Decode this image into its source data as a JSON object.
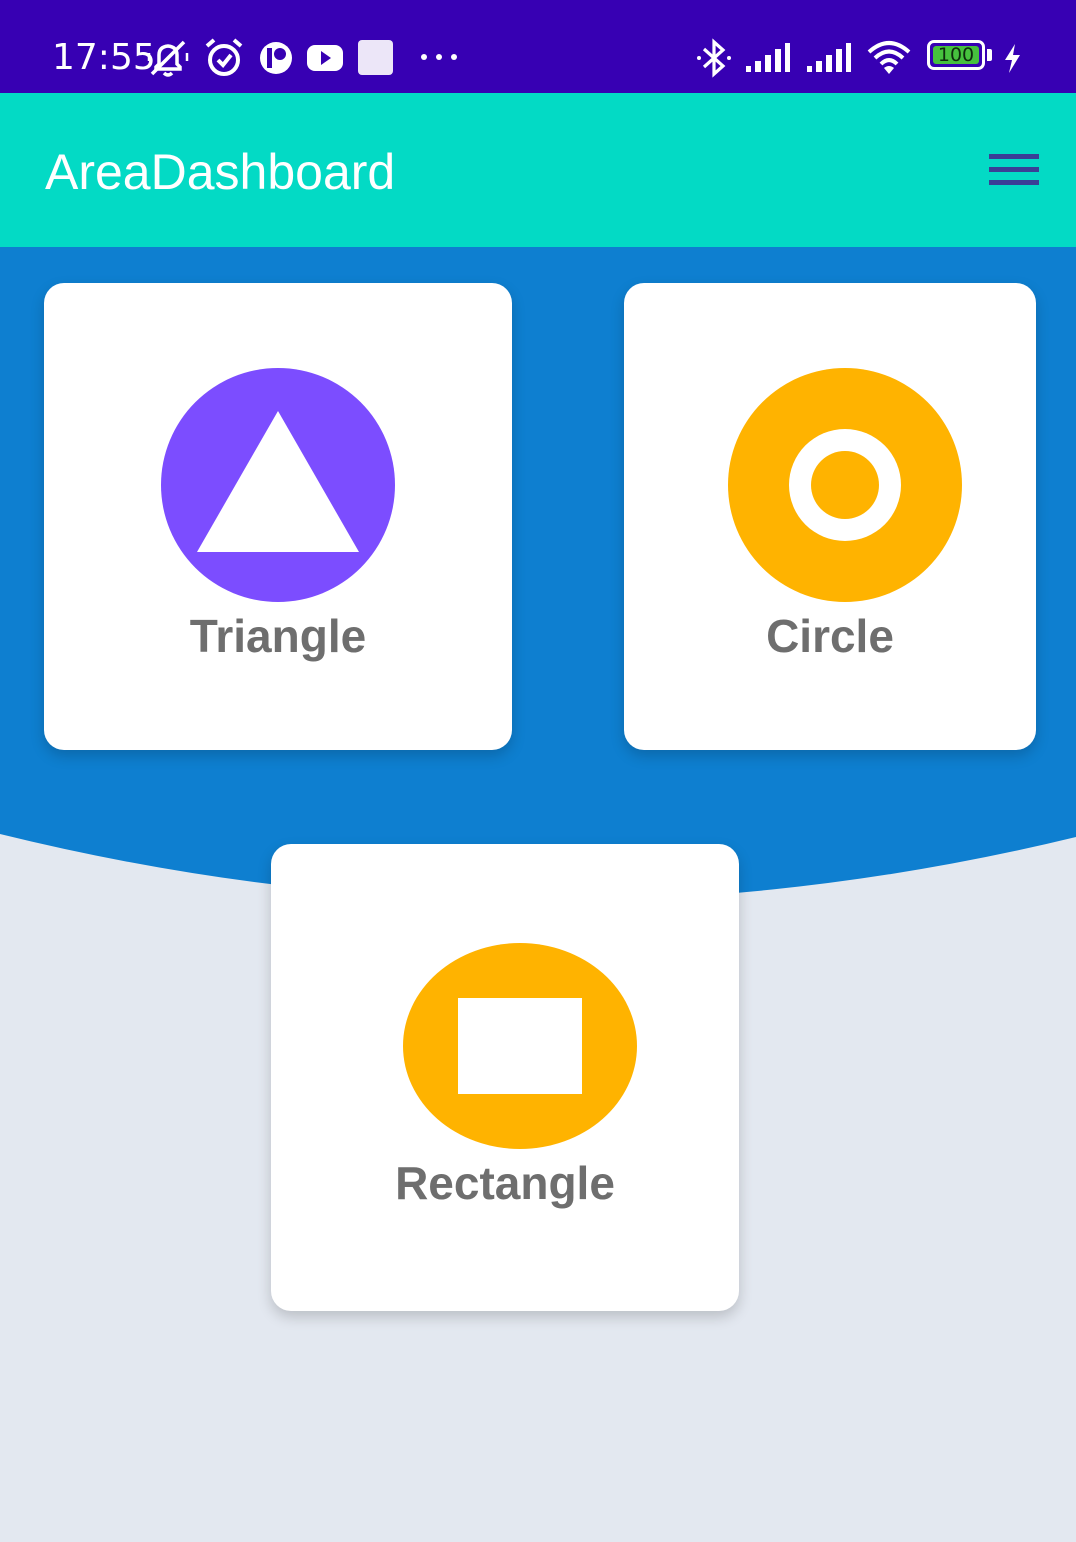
{
  "status_bar": {
    "time": "17:55",
    "battery_level": "100",
    "icons": [
      "mute-notifications-icon",
      "alarm-icon",
      "app-notification-icon",
      "youtube-icon",
      "app-square-icon",
      "more-dots-icon",
      "bluetooth-icon",
      "signal-icon",
      "signal-icon",
      "wifi-icon",
      "battery-icon",
      "charging-icon"
    ]
  },
  "app_bar": {
    "title": "AreaDashboard",
    "menu_icon": "hamburger-menu-icon"
  },
  "colors": {
    "status_bar": "#3700b3",
    "app_bar": "#03dac5",
    "hero": "#0e7fd0",
    "background": "#e3e8f0",
    "purple_accent": "#7c4dff",
    "amber_accent": "#ffb300",
    "label_gray": "#6e6e6e"
  },
  "cards": [
    {
      "label": "Triangle",
      "icon": "triangle-icon",
      "icon_color": "#7c4dff"
    },
    {
      "label": "Circle",
      "icon": "circle-icon",
      "icon_color": "#ffb300"
    },
    {
      "label": "Rectangle",
      "icon": "rectangle-icon",
      "icon_color": "#ffb300"
    }
  ]
}
